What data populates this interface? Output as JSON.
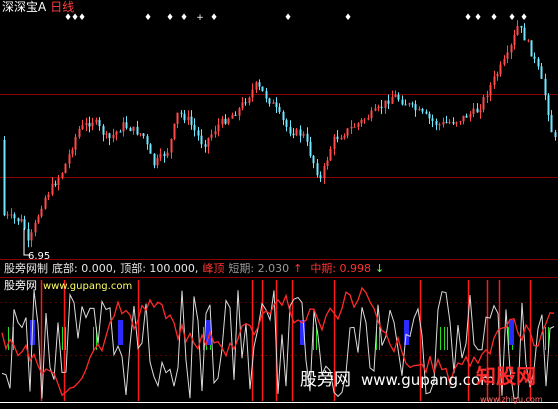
{
  "header": {
    "stock_name": "深深宝A",
    "period": "日线"
  },
  "price_chart": {
    "min_price_label": "6.95",
    "signal_marks": [
      "♦",
      "♦",
      "♦",
      "♦",
      "♦",
      "♦",
      "+",
      "♦",
      "♦",
      "♦",
      "♦",
      "♦",
      "♦",
      "♦",
      "♦"
    ]
  },
  "indicator": {
    "name": "股旁网制",
    "bottom": "底部: 0.000,",
    "top": "顶部: 100.000,",
    "peak": "峰顶",
    "short_term": "短期: 2.030",
    "short_arrow": "↑",
    "mid_term": "中期: 0.998",
    "mid_arrow": "↓"
  },
  "site_label": {
    "name": "股旁网",
    "url": "www.gupang.com"
  },
  "watermark": {
    "text": "股旁网",
    "url": "www.gupang.com"
  },
  "logo": {
    "text": "知股网",
    "url": "www.zhigu.com"
  },
  "colors": {
    "background": "#000000",
    "bull": "#ff4a4a",
    "bear": "#6fe8ff",
    "grid": "#8b0000",
    "line_short": "#dcdcdc",
    "line_mid": "#ff2a2a",
    "bar_green": "#22dd22",
    "bar_blue": "#2b2bff",
    "bar_red": "#ff1a1a"
  }
}
